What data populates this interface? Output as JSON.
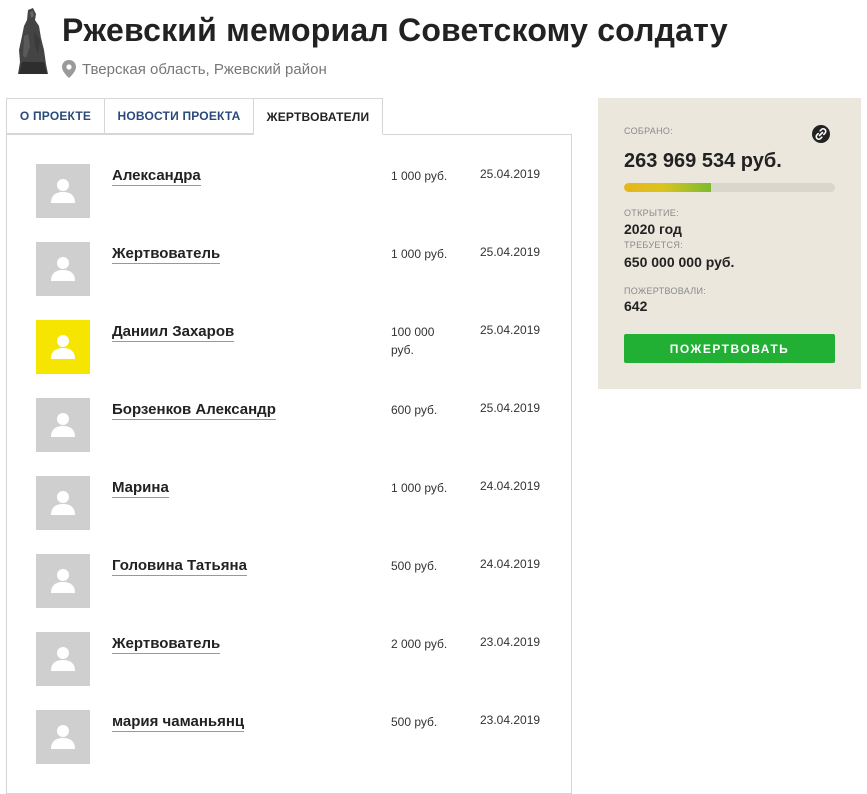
{
  "header": {
    "title": "Ржевский мемориал Советскому солдату",
    "location": "Тверская область, Ржевский район",
    "logo_icon": "memorial-statue-icon",
    "location_icon": "map-pin-icon"
  },
  "tabs": [
    {
      "label": "О ПРОЕКТЕ",
      "active": false
    },
    {
      "label": "НОВОСТИ ПРОЕКТА",
      "active": false
    },
    {
      "label": "ЖЕРТВОВАТЕЛИ",
      "active": true
    }
  ],
  "donors": [
    {
      "name": "Александра",
      "amount": "1 000 руб.",
      "date": "25.04.2019",
      "highlight": false
    },
    {
      "name": "Жертвователь",
      "amount": "1 000 руб.",
      "date": "25.04.2019",
      "highlight": false
    },
    {
      "name": "Даниил Захаров",
      "amount": "100 000 руб.",
      "date": "25.04.2019",
      "highlight": true
    },
    {
      "name": "Борзенков Александр",
      "amount": "600 руб.",
      "date": "25.04.2019",
      "highlight": false
    },
    {
      "name": "Марина",
      "amount": "1 000 руб.",
      "date": "24.04.2019",
      "highlight": false
    },
    {
      "name": "Головина Татьяна",
      "amount": "500 руб.",
      "date": "24.04.2019",
      "highlight": false
    },
    {
      "name": "Жертвователь",
      "amount": "2 000 руб.",
      "date": "23.04.2019",
      "highlight": false
    },
    {
      "name": "мария чаманьянц",
      "amount": "500 руб.",
      "date": "23.04.2019",
      "highlight": false
    }
  ],
  "sidebar": {
    "collected_label": "СОБРАНО:",
    "collected_value": "263 969 534 руб.",
    "progress_fraction": 0.41,
    "opening_label": "ОТКРЫТИЕ:",
    "opening_value": "2020 год",
    "required_label": "ТРЕБУЕТСЯ:",
    "required_value": "650 000 000 руб.",
    "donated_label": "ПОЖЕРТВОВАЛИ:",
    "donated_value": "642",
    "donate_button": "ПОЖЕРТВОВАТЬ",
    "link_icon": "link-icon"
  },
  "colors": {
    "accent_green": "#21b033",
    "tab_link": "#2a4a7c",
    "sidebar_bg": "#ebe7dd",
    "avatar_highlight": "#f5e500",
    "avatar_default": "#cfcfcf"
  }
}
